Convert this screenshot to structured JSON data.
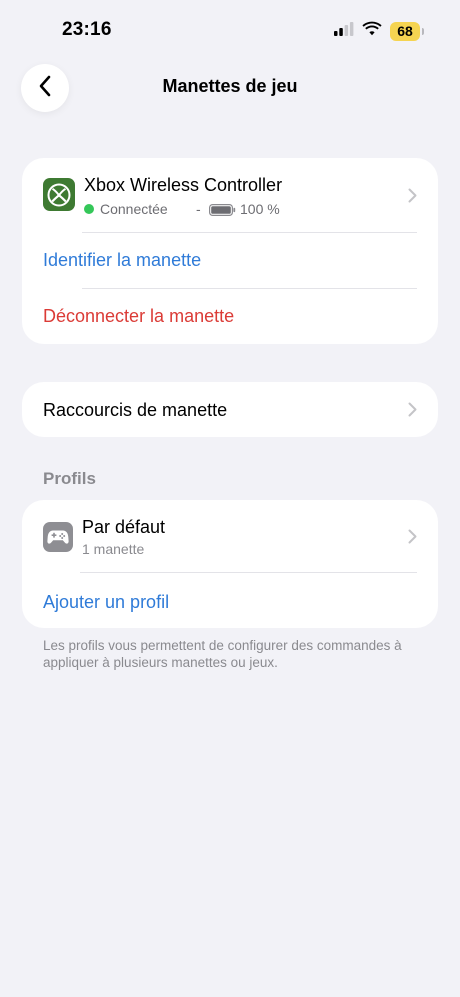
{
  "status_bar": {
    "time": "23:16",
    "battery": "68"
  },
  "nav": {
    "title": "Manettes de jeu"
  },
  "controller": {
    "name": "Xbox Wireless Controller",
    "status": "Connectée",
    "separator": "-",
    "battery": "100 %",
    "identify": "Identifier la manette",
    "disconnect": "Déconnecter la manette"
  },
  "shortcuts": {
    "label": "Raccourcis de manette"
  },
  "profiles": {
    "header": "Profils",
    "items": [
      {
        "name": "Par défaut",
        "subtitle": "1 manette"
      }
    ],
    "add": "Ajouter un profil",
    "footer": "Les profils vous permettent de configurer des commandes à appliquer à plusieurs manettes ou jeux."
  },
  "colors": {
    "blue": "#2f7bd8",
    "red": "#db3b36",
    "green": "#34c759",
    "xbox": "#3e7a32",
    "background": "#f2f2f7"
  }
}
